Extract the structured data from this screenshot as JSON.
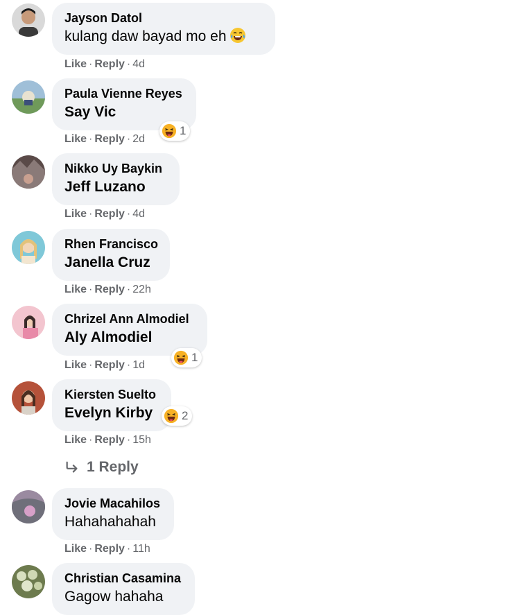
{
  "comments": [
    {
      "name": "Jayson Datol",
      "text": "kulang daw bayad mo eh",
      "time": "4d"
    },
    {
      "name": "Paula Vienne Reyes",
      "text": "Say Vic",
      "time": "2d",
      "reactions": "1"
    },
    {
      "name": "Nikko Uy Baykin",
      "text": "Jeff Luzano",
      "time": "4d"
    },
    {
      "name": "Rhen Francisco",
      "text": "Janella Cruz",
      "time": "22h"
    },
    {
      "name": "Chrizel Ann Almodiel",
      "text": "Aly Almodiel",
      "time": "1d",
      "reactions": "1"
    },
    {
      "name": "Kiersten Suelto",
      "text": "Evelyn Kirby",
      "time": "15h",
      "reactions": "2",
      "replies": "1 Reply"
    },
    {
      "name": "Jovie Macahilos",
      "text": "Hahahahahah",
      "time": "11h"
    },
    {
      "name": "Christian Casamina",
      "text": "Gagow hahaha"
    }
  ],
  "actions": {
    "like": "Like",
    "reply": "Reply",
    "dot": "·"
  },
  "icons": {
    "reaction": "haha-emoji-icon",
    "reply_arrow": "reply-arrow-icon"
  },
  "colors": {
    "bubble": "#f0f2f5",
    "meta": "#65676b",
    "haha": "#f7b125"
  }
}
